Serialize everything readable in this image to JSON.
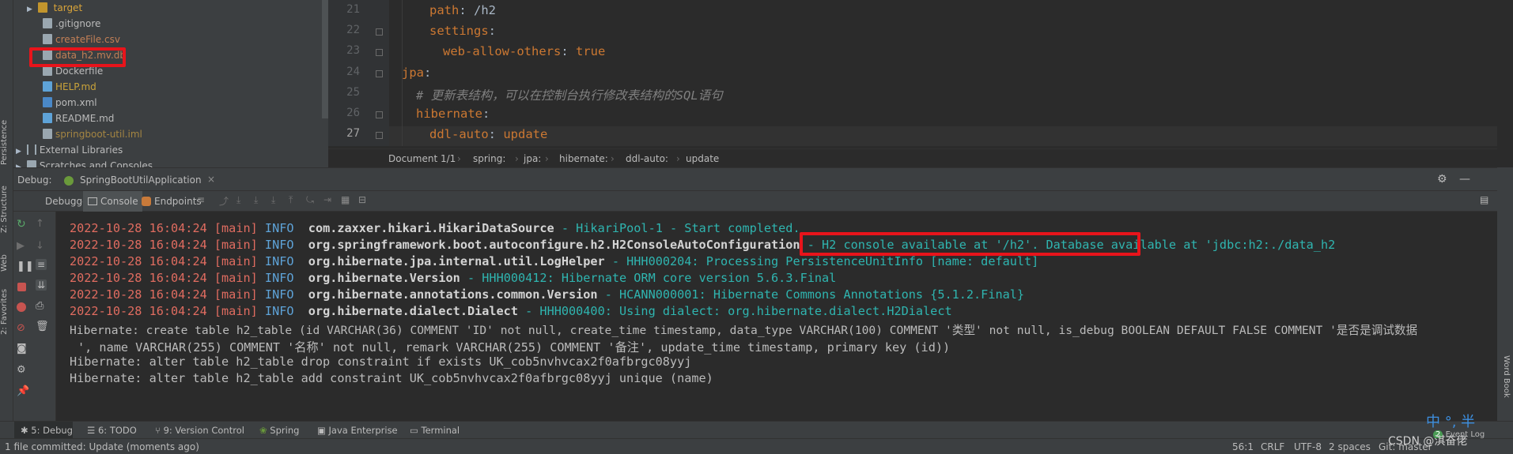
{
  "left_strip": {
    "tabs": [
      "Persistence",
      "Z: Structure",
      "Web",
      "2: Favorites"
    ]
  },
  "project_tree": {
    "items": [
      {
        "label": "target",
        "color": "#d9a43a",
        "icon": "folder-icon"
      },
      {
        "label": ".gitignore",
        "color": "#bbbbbb",
        "icon": "file-icon"
      },
      {
        "label": "createFile.csv",
        "color": "#c27f56",
        "icon": "file-icon"
      },
      {
        "label": "data_h2.mv.db",
        "color": "#c27f56",
        "icon": "file-icon"
      },
      {
        "label": "Dockerfile",
        "color": "#bbbbbb",
        "icon": "file-icon"
      },
      {
        "label": "HELP.md",
        "color": "#c9a33a",
        "icon": "markdown-icon"
      },
      {
        "label": "pom.xml",
        "color": "#bbbbbb",
        "icon": "maven-icon"
      },
      {
        "label": "README.md",
        "color": "#bbbbbb",
        "icon": "markdown-icon"
      },
      {
        "label": "springboot-util.iml",
        "color": "#a48542",
        "icon": "file-icon"
      },
      {
        "label": "External Libraries",
        "color": "#bbbbbb",
        "icon": "library-icon"
      },
      {
        "label": "Scratches and Consoles",
        "color": "#bbbbbb",
        "icon": "scratch-icon"
      }
    ]
  },
  "editor": {
    "line_numbers": [
      "21",
      "22",
      "23",
      "24",
      "25",
      "26",
      "27"
    ],
    "lines": [
      {
        "key": "path",
        "sep": ": ",
        "val": "/h2"
      },
      {
        "key": "settings",
        "sep": ":",
        "val": ""
      },
      {
        "key": "web-allow-others",
        "sep": ": ",
        "val": "true"
      },
      {
        "key": "jpa",
        "sep": ":",
        "val": ""
      },
      {
        "comment": "# 更新表结构，可以在控制台执行修改表结构的SQL语句"
      },
      {
        "key": "hibernate",
        "sep": ":",
        "val": ""
      },
      {
        "key": "ddl-auto",
        "sep": ": ",
        "val": "update"
      }
    ],
    "breadcrumb": [
      "Document 1/1",
      "spring:",
      "jpa:",
      "hibernate:",
      "ddl-auto:",
      "update"
    ]
  },
  "debug": {
    "label": "Debug:",
    "session": "SpringBootUtilApplication",
    "tabs": [
      "Debugger",
      "Console",
      "Endpoints"
    ]
  },
  "console": {
    "lines": [
      {
        "date": "2022-10-28 16:04:24",
        "thread": "[main]",
        "level": "INFO",
        "logger": "com.zaxxer.hikari.HikariDataSource",
        "message": "HikariPool-1 - Start completed."
      },
      {
        "date": "2022-10-28 16:04:24",
        "thread": "[main]",
        "level": "INFO",
        "logger": "org.springframework.boot.autoconfigure.h2.H2ConsoleAutoConfiguration",
        "message": "H2 console available at '/h2'. Database available at 'jdbc:h2:./data_h2"
      },
      {
        "date": "2022-10-28 16:04:24",
        "thread": "[main]",
        "level": "INFO",
        "logger": "org.hibernate.jpa.internal.util.LogHelper",
        "message": "HHH000204: Processing PersistenceUnitInfo [name: default]"
      },
      {
        "date": "2022-10-28 16:04:24",
        "thread": "[main]",
        "level": "INFO",
        "logger": "org.hibernate.Version",
        "message": "HHH000412: Hibernate ORM core version 5.6.3.Final"
      },
      {
        "date": "2022-10-28 16:04:24",
        "thread": "[main]",
        "level": "INFO",
        "logger": "org.hibernate.annotations.common.Version",
        "message": "HCANN000001: Hibernate Commons Annotations {5.1.2.Final}"
      },
      {
        "date": "2022-10-28 16:04:24",
        "thread": "[main]",
        "level": "INFO",
        "logger": "org.hibernate.dialect.Dialect",
        "message": "HHH000400: Using dialect: org.hibernate.dialect.H2Dialect"
      }
    ],
    "plain": [
      "Hibernate: create table h2_table (id VARCHAR(36) COMMENT 'ID' not null, create_time timestamp, data_type VARCHAR(100) COMMENT '类型' not null, is_debug BOOLEAN DEFAULT FALSE COMMENT '是否是调试数据",
      "', name VARCHAR(255) COMMENT '名称' not null, remark VARCHAR(255) COMMENT '备注', update_time timestamp, primary key (id))",
      "Hibernate: alter table h2_table drop constraint if exists UK_cob5nvhvcax2f0afbrgc08yyj",
      "Hibernate: alter table h2_table add constraint UK_cob5nvhvcax2f0afbrgc08yyj unique (name)"
    ]
  },
  "bottom_tabs": [
    "5: Debug",
    "6: TODO",
    "9: Version Control",
    "Spring",
    "Java Enterprise",
    "Terminal"
  ],
  "status": {
    "message": "1 file committed: Update (moments ago)",
    "position": "56:1",
    "line_sep": "CRLF",
    "encoding": "UTF-8",
    "indent": "2 spaces",
    "git": "Git: master",
    "event_log": "Event Log",
    "event_count": "2",
    "ime": "中 °, 半",
    "watermark": "CSDN @淇奋佬",
    "word_book": "Word Book"
  }
}
